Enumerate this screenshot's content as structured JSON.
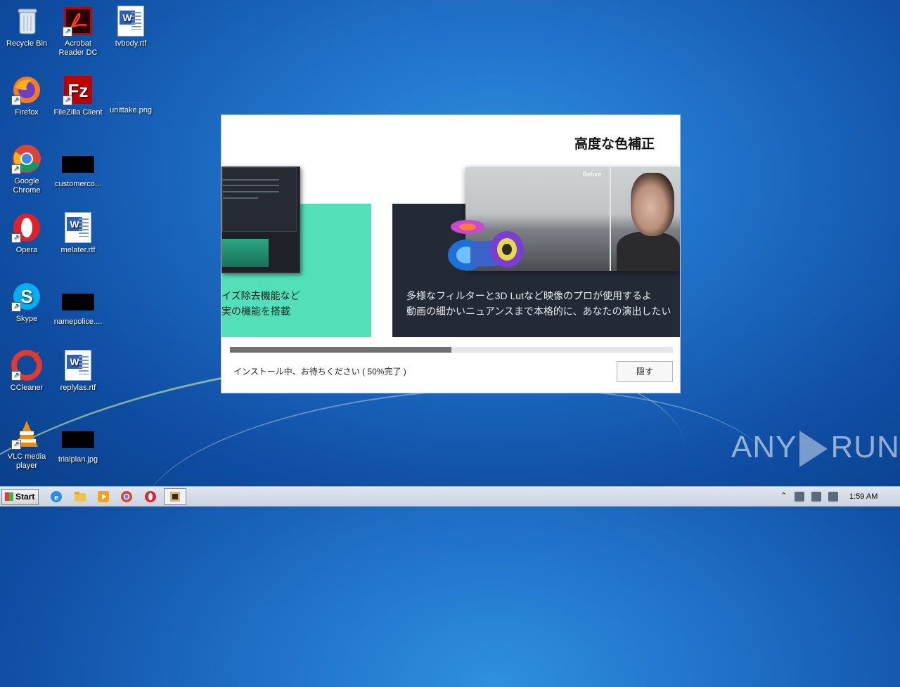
{
  "desktop": {
    "icons": [
      {
        "label": "Recycle Bin"
      },
      {
        "label": "Acrobat\nReader DC"
      },
      {
        "label": "tvbody.rtf"
      },
      {
        "label": "Firefox"
      },
      {
        "label": "FileZilla Client"
      },
      {
        "label": "unittake.png"
      },
      {
        "label": "Google\nChrome"
      },
      {
        "label": "customerco..."
      },
      {
        "label": "Opera"
      },
      {
        "label": "melater.rtf"
      },
      {
        "label": "Skype"
      },
      {
        "label": "namepolice...."
      },
      {
        "label": "CCleaner"
      },
      {
        "label": "replylas.rtf"
      },
      {
        "label": "VLC media\nplayer"
      },
      {
        "label": "trialplan.jpg"
      }
    ]
  },
  "installer": {
    "title": "高度な色補正",
    "left_text_1": "イズ除去機能など",
    "left_text_2": "実の機能を搭載",
    "right_text_1": "多様なフィルターと3D Lutなど映像のプロが使用するよ",
    "right_text_2": "動画の細かいニュアンスまで本格的に、あなたの演出したい",
    "photo_label": "Before",
    "progress_percent": 50,
    "status": "インストール中、お待ちください ( 50%完了 )",
    "hide_label": "隠す"
  },
  "watermark": {
    "text_left": "ANY",
    "text_right": "RUN"
  },
  "taskbar": {
    "start_label": "Start",
    "clock": "1:59 AM"
  },
  "colors": {
    "green_panel": "#52e0b9",
    "dark_panel": "#232a36",
    "progress": "#6f6f6f"
  }
}
